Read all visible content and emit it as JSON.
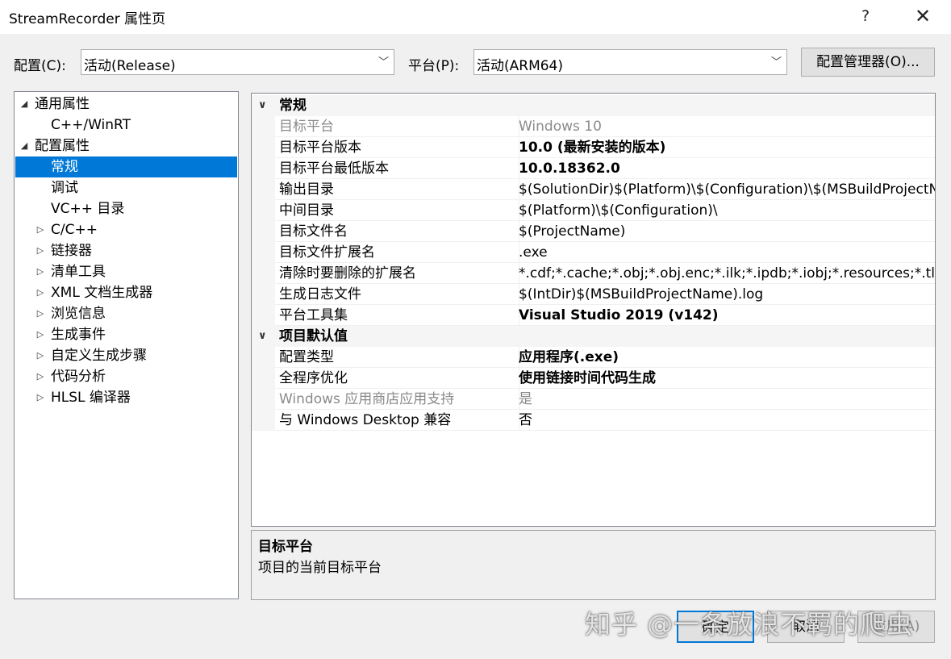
{
  "window": {
    "title": "StreamRecorder 属性页",
    "help": "?",
    "close": "✕"
  },
  "config": {
    "config_label": "配置(C):",
    "config_value": "活动(Release)",
    "platform_label": "平台(P):",
    "platform_value": "活动(ARM64)",
    "manager_button": "配置管理器(O)..."
  },
  "tree": [
    {
      "label": "通用属性",
      "arrow": "◢",
      "level": 0
    },
    {
      "label": "C++/WinRT",
      "arrow": "",
      "level": 1
    },
    {
      "label": "配置属性",
      "arrow": "◢",
      "level": 0
    },
    {
      "label": "常规",
      "arrow": "",
      "level": 1,
      "selected": true
    },
    {
      "label": "调试",
      "arrow": "",
      "level": 1
    },
    {
      "label": "VC++ 目录",
      "arrow": "",
      "level": 1
    },
    {
      "label": "C/C++",
      "arrow": "▷",
      "level": 1
    },
    {
      "label": "链接器",
      "arrow": "▷",
      "level": 1
    },
    {
      "label": "清单工具",
      "arrow": "▷",
      "level": 1
    },
    {
      "label": "XML 文档生成器",
      "arrow": "▷",
      "level": 1
    },
    {
      "label": "浏览信息",
      "arrow": "▷",
      "level": 1
    },
    {
      "label": "生成事件",
      "arrow": "▷",
      "level": 1
    },
    {
      "label": "自定义生成步骤",
      "arrow": "▷",
      "level": 1
    },
    {
      "label": "代码分析",
      "arrow": "▷",
      "level": 1
    },
    {
      "label": "HLSL 编译器",
      "arrow": "▷",
      "level": 1
    }
  ],
  "grid": {
    "sections": [
      {
        "title": "常规",
        "rows": [
          {
            "name": "目标平台",
            "value": "Windows 10",
            "bold": false,
            "dim": true
          },
          {
            "name": "目标平台版本",
            "value": "10.0 (最新安装的版本)",
            "bold": true,
            "dim": false
          },
          {
            "name": "目标平台最低版本",
            "value": "10.0.18362.0",
            "bold": true,
            "dim": false
          },
          {
            "name": "输出目录",
            "value": "$(SolutionDir)$(Platform)\\$(Configuration)\\$(MSBuildProjectName)\\",
            "bold": false,
            "dim": false
          },
          {
            "name": "中间目录",
            "value": "$(Platform)\\$(Configuration)\\",
            "bold": false,
            "dim": false
          },
          {
            "name": "目标文件名",
            "value": "$(ProjectName)",
            "bold": false,
            "dim": false
          },
          {
            "name": "目标文件扩展名",
            "value": ".exe",
            "bold": false,
            "dim": false
          },
          {
            "name": "清除时要删除的扩展名",
            "value": "*.cdf;*.cache;*.obj;*.obj.enc;*.ilk;*.ipdb;*.iobj;*.resources;*.tlb;*.tli;*.tlh",
            "bold": false,
            "dim": false
          },
          {
            "name": "生成日志文件",
            "value": "$(IntDir)$(MSBuildProjectName).log",
            "bold": false,
            "dim": false
          },
          {
            "name": "平台工具集",
            "value": "Visual Studio 2019 (v142)",
            "bold": true,
            "dim": false
          }
        ]
      },
      {
        "title": "项目默认值",
        "rows": [
          {
            "name": "配置类型",
            "value": "应用程序(.exe)",
            "bold": true,
            "dim": false
          },
          {
            "name": "全程序优化",
            "value": "使用链接时间代码生成",
            "bold": true,
            "dim": false
          },
          {
            "name": "Windows 应用商店应用支持",
            "value": "是",
            "bold": false,
            "dim": true
          },
          {
            "name": "与 Windows Desktop 兼容",
            "value": "否",
            "bold": false,
            "dim": false
          }
        ]
      }
    ]
  },
  "description": {
    "title": "目标平台",
    "text": "项目的当前目标平台"
  },
  "buttons": {
    "ok": "确定",
    "cancel": "取消",
    "apply": "应用(A)"
  },
  "watermark": "知乎 @一条放浪不羁的爬虫"
}
